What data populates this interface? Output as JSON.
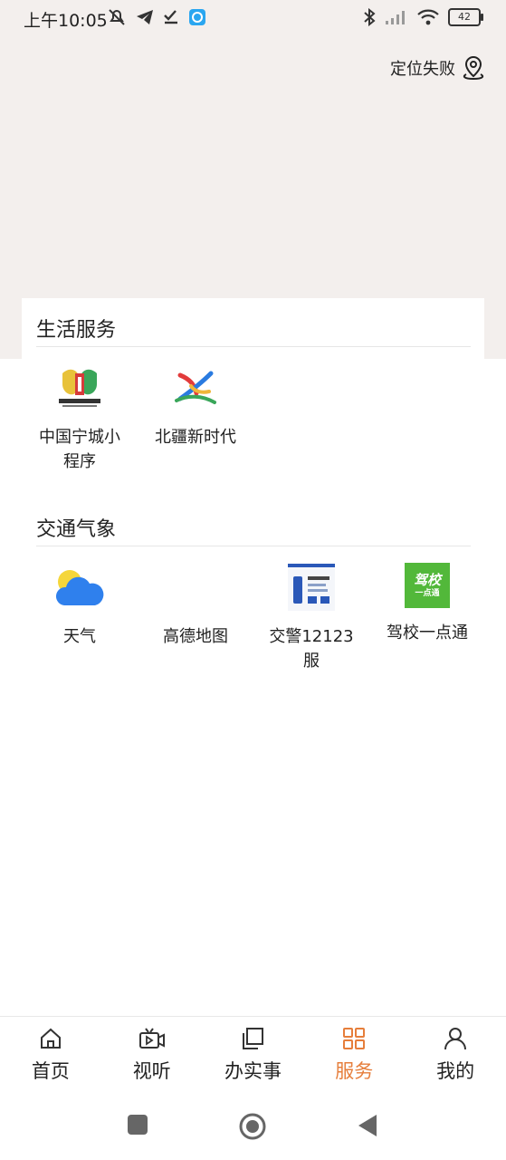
{
  "status_bar": {
    "time": "上午10:05",
    "battery": "42"
  },
  "header": {
    "location_text": "定位失败"
  },
  "sections": [
    {
      "title": "生活服务",
      "items": [
        {
          "label": "中国宁城小程序",
          "icon": "ningcheng-logo-icon"
        },
        {
          "label": "北疆新时代",
          "icon": "beijiang-logo-icon"
        }
      ]
    },
    {
      "title": "交通气象",
      "items": [
        {
          "label": "天气",
          "icon": "weather-icon"
        },
        {
          "label": "高德地图",
          "icon": "amap-icon"
        },
        {
          "label": "交警12123服",
          "icon": "traffic-police-icon"
        },
        {
          "label": "驾校一点通",
          "icon": "driving-school-icon"
        }
      ]
    }
  ],
  "driving_icon_text": {
    "line1": "驾校",
    "line2": "一点通"
  },
  "tabs": [
    {
      "label": "首页",
      "icon": "home-icon"
    },
    {
      "label": "视听",
      "icon": "video-icon"
    },
    {
      "label": "办实事",
      "icon": "documents-icon"
    },
    {
      "label": "服务",
      "icon": "services-grid-icon",
      "active": true
    },
    {
      "label": "我的",
      "icon": "profile-icon"
    }
  ],
  "colors": {
    "accent": "#e67e3b",
    "header_bg": "#f3efed"
  }
}
